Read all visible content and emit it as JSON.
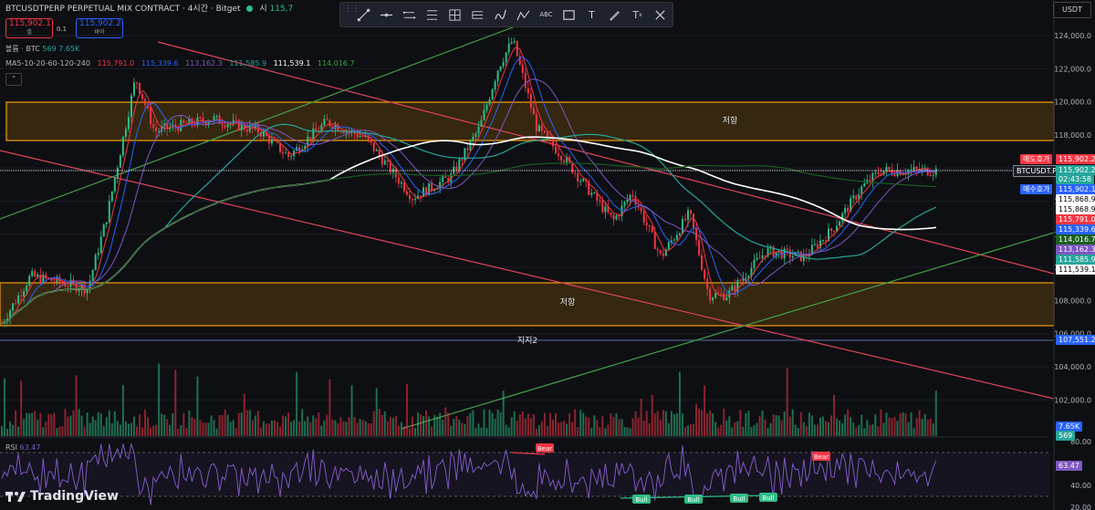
{
  "header": {
    "symbol_title": "BTCUSDTPERP PERPETUAL MIX CONTRACT · 4시간 · Bitget",
    "open_label": "시",
    "open_value": "115,7"
  },
  "order_panel": {
    "sell_price": "115,902.1",
    "sell_label": "셀",
    "spread": "0.1",
    "buy_price": "115,902.2",
    "buy_label": "바이"
  },
  "volume_legend": {
    "label": "볼륨 · BTC",
    "v1": "569",
    "v2": "7.65K"
  },
  "ma_legend": {
    "label": "MA5-10-20-60-120-240",
    "values": [
      "115,791.0",
      "115,339.6",
      "113,162.3",
      "111,585.9",
      "111,539.1",
      "114,016.7"
    ]
  },
  "toolbar": {
    "tools": [
      "cursor-line-icon",
      "horizontal-line-icon",
      "parallel-channel-icon",
      "fib-retracement-icon",
      "grid-icon",
      "pitchfork-icon",
      "wave-icon",
      "abc-pattern-icon",
      "rectangle-icon",
      "text-icon",
      "brush-icon",
      "text-style-icon"
    ],
    "text_tool": "T",
    "text_style_tool": "T",
    "abc_tool": "ABC"
  },
  "currency_selector": "USDT",
  "annotations": {
    "resistance_upper": "저항",
    "resistance_lower": "저항",
    "support_label": "지지2"
  },
  "price_axis": {
    "ticks": [
      "124,000.0",
      "122,000.0",
      "120,000.0",
      "118,000.0",
      "116,000.0",
      "114,000.0",
      "112,000.0",
      "110,000.0",
      "108,000.0",
      "106,000.0",
      "104,000.0",
      "102,000.0"
    ],
    "rsi_ticks": [
      "80.00",
      "40.00",
      "20.00"
    ]
  },
  "price_labels": {
    "ask_label": "매도호가",
    "ask_value": "115,902.2",
    "symbol_tag": "BTCUSDT.P",
    "last_price": "115,902.2",
    "countdown": "02:43:58",
    "bid_label": "매수호가",
    "bid_value": "115,902.1",
    "others": [
      "115,868.9",
      "115,868.9",
      "115,791.0",
      "115,339.6",
      "114,016.7",
      "113,162.3",
      "111,585.9",
      "111,539.1"
    ],
    "support_value": "107,551.2",
    "volume_value": "7.65K",
    "volume_value2": "569",
    "rsi_value": "63.47"
  },
  "rsi": {
    "label": "RSI",
    "value": "63.47",
    "divergence_labels": [
      "Bear",
      "Bear",
      "Bull",
      "Bull",
      "Bull",
      "Bull"
    ]
  },
  "branding": {
    "logo_text": "TradingView"
  },
  "colors": {
    "background": "#0e0f13",
    "up": "#2ebd85",
    "down": "#f23645",
    "zone_fill": "#3d2b12",
    "zone_border": "#f59e0b",
    "ma5": "#f23645",
    "ma10": "#2962ff",
    "ma20": "#7e57c2",
    "ma60": "#26a69a",
    "ma120": "#ffffff",
    "ma240": "#1b5e20",
    "rsi_line": "#7e57c2"
  },
  "chart_data": {
    "type": "candlestick",
    "title": "BTCUSDTPERP PERPETUAL MIX CONTRACT · 4시간 · Bitget",
    "ylim": [
      105000,
      125000
    ],
    "y_ticks": [
      102000,
      104000,
      106000,
      108000,
      110000,
      112000,
      114000,
      116000,
      118000,
      120000,
      122000,
      124000
    ],
    "last_price": 115902.2,
    "zones": [
      {
        "label": "저항",
        "from": 117800,
        "to": 119800
      },
      {
        "label": "저항",
        "from": 106900,
        "to": 109200
      }
    ],
    "support_line": {
      "label": "지지2",
      "value": 107551.2
    },
    "price_anchors": [
      {
        "t": 0,
        "price": 106200
      },
      {
        "t": 0.03,
        "price": 109200
      },
      {
        "t": 0.09,
        "price": 108400
      },
      {
        "t": 0.11,
        "price": 113000
      },
      {
        "t": 0.14,
        "price": 121800
      },
      {
        "t": 0.16,
        "price": 118400
      },
      {
        "t": 0.22,
        "price": 119200
      },
      {
        "t": 0.27,
        "price": 118400
      },
      {
        "t": 0.3,
        "price": 116800
      },
      {
        "t": 0.34,
        "price": 119000
      },
      {
        "t": 0.38,
        "price": 118000
      },
      {
        "t": 0.43,
        "price": 114200
      },
      {
        "t": 0.47,
        "price": 115500
      },
      {
        "t": 0.5,
        "price": 118600
      },
      {
        "t": 0.52,
        "price": 122500
      },
      {
        "t": 0.535,
        "price": 124200
      },
      {
        "t": 0.56,
        "price": 118600
      },
      {
        "t": 0.59,
        "price": 116600
      },
      {
        "t": 0.61,
        "price": 115000
      },
      {
        "t": 0.64,
        "price": 112700
      },
      {
        "t": 0.66,
        "price": 114500
      },
      {
        "t": 0.69,
        "price": 110400
      },
      {
        "t": 0.72,
        "price": 113200
      },
      {
        "t": 0.74,
        "price": 108000
      },
      {
        "t": 0.76,
        "price": 108000
      },
      {
        "t": 0.8,
        "price": 110800
      },
      {
        "t": 0.84,
        "price": 110400
      },
      {
        "t": 0.87,
        "price": 112200
      },
      {
        "t": 0.9,
        "price": 114800
      },
      {
        "t": 0.92,
        "price": 115900
      }
    ],
    "moving_averages": [
      {
        "name": "MA5",
        "value": 115791.0
      },
      {
        "name": "MA10",
        "value": 115339.6
      },
      {
        "name": "MA20",
        "value": 113162.3
      },
      {
        "name": "MA60",
        "value": 111585.9
      },
      {
        "name": "MA120",
        "value": 111539.1
      },
      {
        "name": "MA240",
        "value": 114016.7
      }
    ],
    "rsi": {
      "ylim": [
        20,
        80
      ],
      "ticks": [
        20,
        40,
        80
      ],
      "last": 63.47
    }
  }
}
